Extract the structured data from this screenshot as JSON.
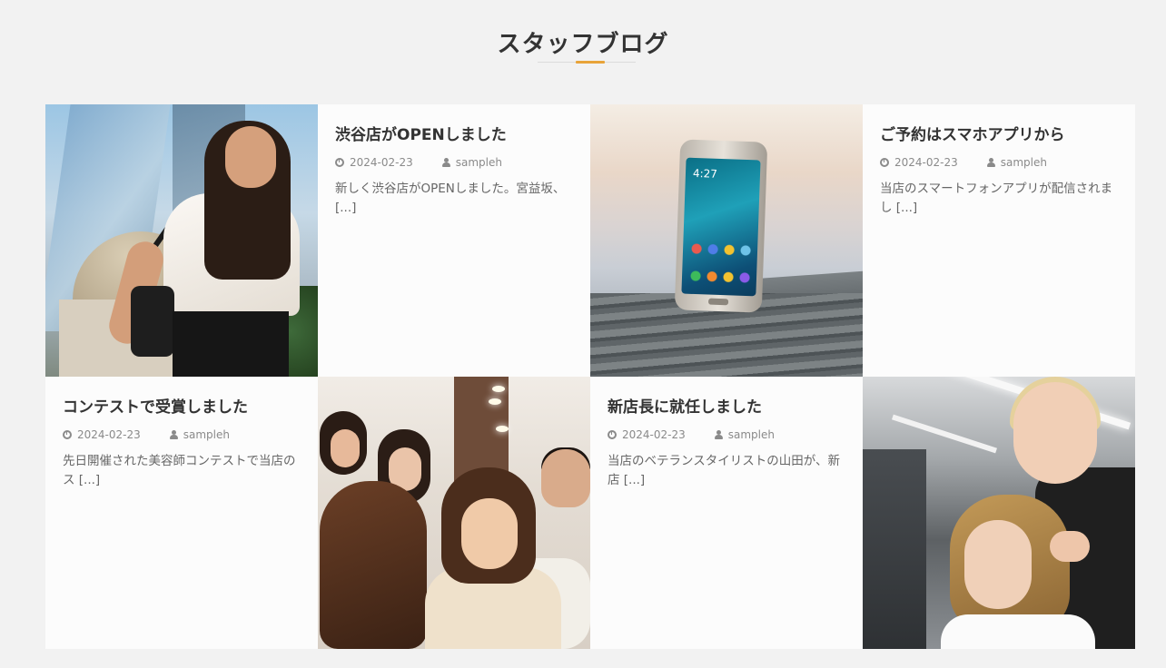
{
  "section": {
    "title": "スタッフブログ"
  },
  "posts": [
    {
      "title": "渋谷店がOPENしました",
      "date": "2024-02-23",
      "author": "sampleh",
      "excerpt": "新しく渋谷店がOPENしました。宮益坂、 [...]"
    },
    {
      "title": "ご予約はスマホアプリから",
      "date": "2024-02-23",
      "author": "sampleh",
      "excerpt": "当店のスマートフォンアプリが配信されまし [...]"
    },
    {
      "title": "コンテストで受賞しました",
      "date": "2024-02-23",
      "author": "sampleh",
      "excerpt": "先日開催された美容師コンテストで当店のス [...]"
    },
    {
      "title": "新店長に就任しました",
      "date": "2024-02-23",
      "author": "sampleh",
      "excerpt": "当店のベテランスタイリストの山田が、新店 [...]"
    }
  ],
  "phone_screen_time": "4:27",
  "colors": {
    "accent": "#e8a43a",
    "background": "#f2f2f2",
    "card": "#fcfcfc"
  }
}
